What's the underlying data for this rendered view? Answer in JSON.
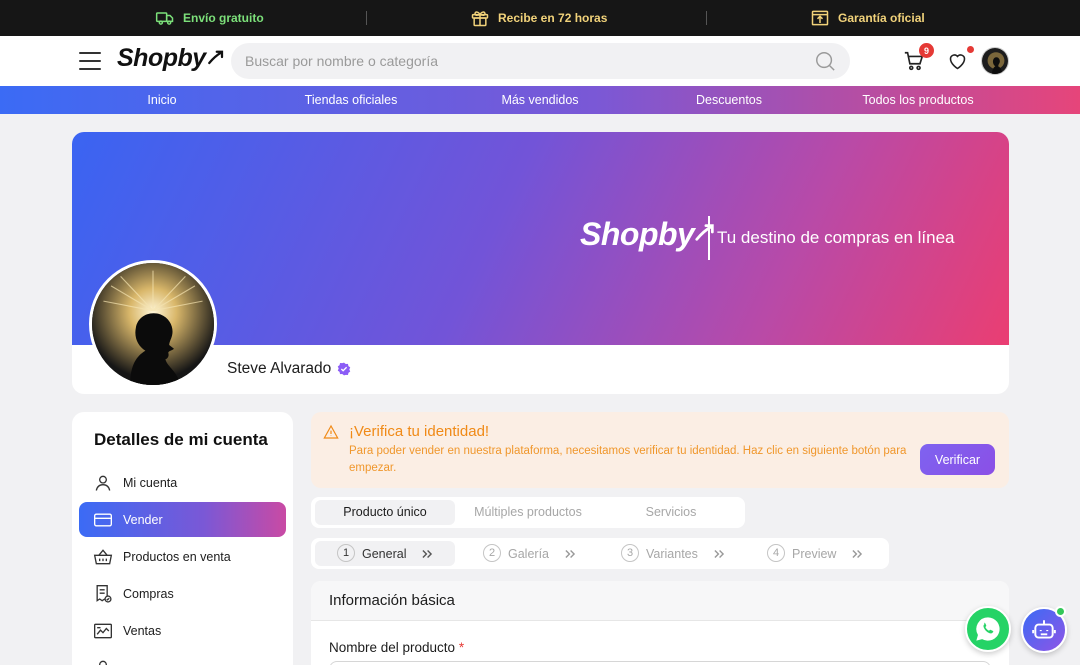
{
  "promo": {
    "items": [
      {
        "label": "Envío gratuito",
        "icon": "truck-icon"
      },
      {
        "label": "Recibe en 72 horas",
        "icon": "gift-icon"
      },
      {
        "label": "Garantía oficial",
        "icon": "box-icon"
      }
    ]
  },
  "header": {
    "logo": "Shopby",
    "search_placeholder": "Buscar por nombre o categoría",
    "cart_count": "9"
  },
  "nav": {
    "items": [
      "Inicio",
      "Tiendas oficiales",
      "Más vendidos",
      "Descuentos",
      "Todos los productos"
    ]
  },
  "profile": {
    "banner_logo": "Shopby",
    "banner_tagline": "Tu destino de compras en línea",
    "name": "Steve Alvarado"
  },
  "sidebar": {
    "title": "Detalles de mi cuenta",
    "items": [
      {
        "label": "Mi cuenta",
        "icon": "user-icon"
      },
      {
        "label": "Vender",
        "icon": "card-icon",
        "active": true
      },
      {
        "label": "Productos en venta",
        "icon": "basket-icon"
      },
      {
        "label": "Compras",
        "icon": "receipt-icon"
      },
      {
        "label": "Ventas",
        "icon": "sales-chart-icon"
      }
    ]
  },
  "alert": {
    "title": "¡Verifica tu identidad!",
    "text": "Para poder vender en nuestra plataforma, necesitamos verificar tu identidad. Haz clic en siguiente botón para empezar.",
    "button": "Verificar"
  },
  "product_tabs": [
    "Producto único",
    "Múltiples productos",
    "Servicios"
  ],
  "steps": [
    {
      "num": "1",
      "label": "General"
    },
    {
      "num": "2",
      "label": "Galería"
    },
    {
      "num": "3",
      "label": "Variantes"
    },
    {
      "num": "4",
      "label": "Preview"
    }
  ],
  "form": {
    "section_title": "Información básica",
    "product_name_label": "Nombre del producto",
    "required_mark": "*"
  },
  "colors": {
    "accent_start": "#3b6bf5",
    "accent_mid": "#7a58d6",
    "accent_end": "#e6457a",
    "alert_text": "#f08a17"
  }
}
